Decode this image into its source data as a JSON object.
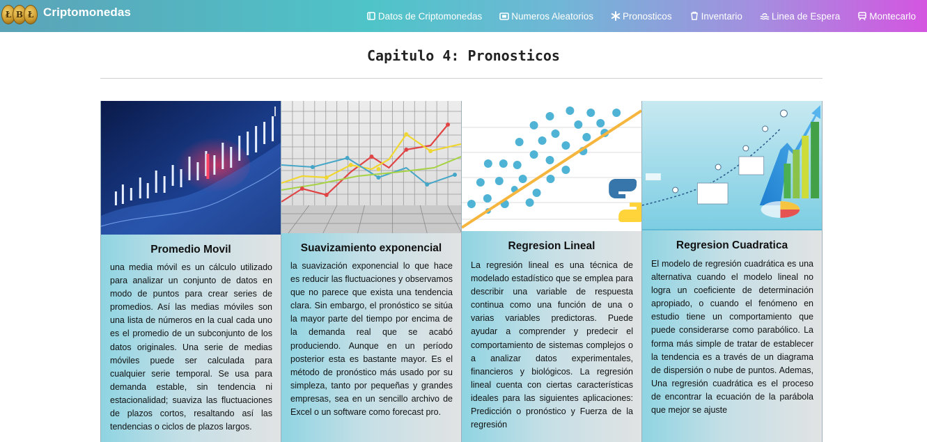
{
  "brand": {
    "name": "Criptomonedas",
    "coin_letters": [
      "Ł",
      "B",
      "Ł"
    ]
  },
  "nav": {
    "items": [
      {
        "label": "Datos de Criptomonedas",
        "icon": "book-icon"
      },
      {
        "label": "Numeros Aleatorios",
        "icon": "card-icon"
      },
      {
        "label": "Pronosticos",
        "icon": "asterisk-icon"
      },
      {
        "label": "Inventario",
        "icon": "cup-icon"
      },
      {
        "label": "Linea de Espera",
        "icon": "waves-icon"
      },
      {
        "label": "Montecarlo",
        "icon": "tram-icon"
      }
    ]
  },
  "page": {
    "title": "Capitulo 4: Pronosticos"
  },
  "cards": [
    {
      "title": "Promedio Movil",
      "text": "una media móvil es un cálculo utilizado para analizar un conjunto de datos en modo de puntos para crear series de promedios. Así las medias móviles son una lista de números en la cual cada uno es el promedio de un subconjunto de los datos originales. Una serie de medias móviles puede ser calculada para cualquier serie temporal. Se usa para demanda estable, sin tendencia ni estacionalidad; suaviza las fluctuaciones de plazos cortos, resaltando así las tendencias o ciclos de plazos largos."
    },
    {
      "title": "Suavizamiento exponencial",
      "text": "la suavización exponencial lo que hace es reducir las fluctuaciones y observamos que no parece que exista una tendencia clara. Sin embargo, el pronóstico se sitúa la mayor parte del tiempo por encima de la demanda real que se acabó produciendo. Aunque en un período posterior esta es bastante mayor. Es el método de pronóstico más usado por su simpleza, tanto por pequeñas y grandes empresas, sea en un sencillo archivo de Excel o un software como forecast pro."
    },
    {
      "title": "Regresion Lineal",
      "text": "La regresión lineal es una técnica de modelado estadístico que se emplea para describir una variable de respuesta continua como una función de una o varias variables predictoras. Puede ayudar a comprender y predecir el comportamiento de sistemas complejos o a analizar datos experimentales, financieros y biológicos. La regresión lineal cuenta con ciertas características ideales para las siguientes aplicaciones: Predicción o pronóstico y Fuerza de la regresión"
    },
    {
      "title": "Regresion Cuadratica",
      "text": "El modelo de regresión cuadrática es una alternativa cuando el modelo lineal no logra un coeficiente de determinación apropiado, o cuando el fenómeno en estudio tiene un comportamiento que puede considerarse como parabólico. La forma más simple de tratar de establecer la tendencia es a través de un diagrama de dispersión o nube de puntos. Ademas, Una regresión cuadrática es el proceso de encontrar la ecuación de la parábola que mejor se ajuste"
    }
  ]
}
